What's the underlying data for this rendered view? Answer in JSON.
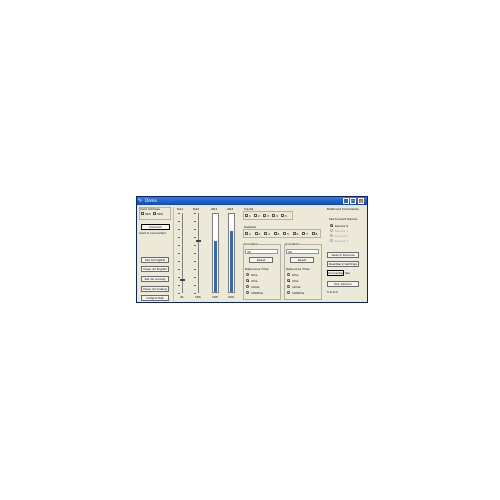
{
  "window": {
    "title": "Demo"
  },
  "card_address": {
    "label": "Card Address",
    "options": [
      "SK5",
      "SK6"
    ],
    "status": "Card 0 connected"
  },
  "buttons": {
    "connect": "Connect",
    "set_all_digital": "Set All Digital",
    "clear_all_digital": "Clear All Digital",
    "set_all_analog": "Set All Analog",
    "clear_all_analog": "Clear All Analog",
    "output_test": "Output Test"
  },
  "da1": {
    "label": "DA1",
    "value": "41",
    "level": 0.16
  },
  "da2": {
    "label": "DA2",
    "value": "165",
    "level": 0.65
  },
  "ad1": {
    "label": "AD1",
    "value": "165",
    "level": 0.65
  },
  "ad2": {
    "label": "AD2",
    "value": "200",
    "level": 0.78
  },
  "inputs": {
    "label": "Inputs",
    "items": [
      "1",
      "2",
      "3",
      "4",
      "5"
    ]
  },
  "outputs": {
    "label": "Outputs",
    "items": [
      "1",
      "2",
      "3",
      "4",
      "5",
      "6",
      "7",
      "8"
    ]
  },
  "counter1": {
    "label": "Counter1",
    "value": "39",
    "reset": "Reset",
    "debounce_label": "Debounce Time",
    "options": [
      "0ms",
      "2ms",
      "10ms",
      "1000ms"
    ]
  },
  "counter2": {
    "label": "Counter2",
    "value": "26",
    "reset": "Reset",
    "debounce_label": "Debounce Time",
    "options": [
      "0ms",
      "2ms",
      "10ms",
      "1000ms"
    ]
  },
  "multicard": {
    "label": "Multicard Commands",
    "set_current_label": "Set Current Device",
    "devices": [
      "Device 0",
      "Device 1",
      "Device 2",
      "Device 3"
    ],
    "search_devices": "Search Devices",
    "readback_settings": "Readback Settings",
    "connected": "Connected",
    "connected_value": "Yes",
    "dll_version": "DLL Version",
    "version_value": "5.0.0.0"
  }
}
